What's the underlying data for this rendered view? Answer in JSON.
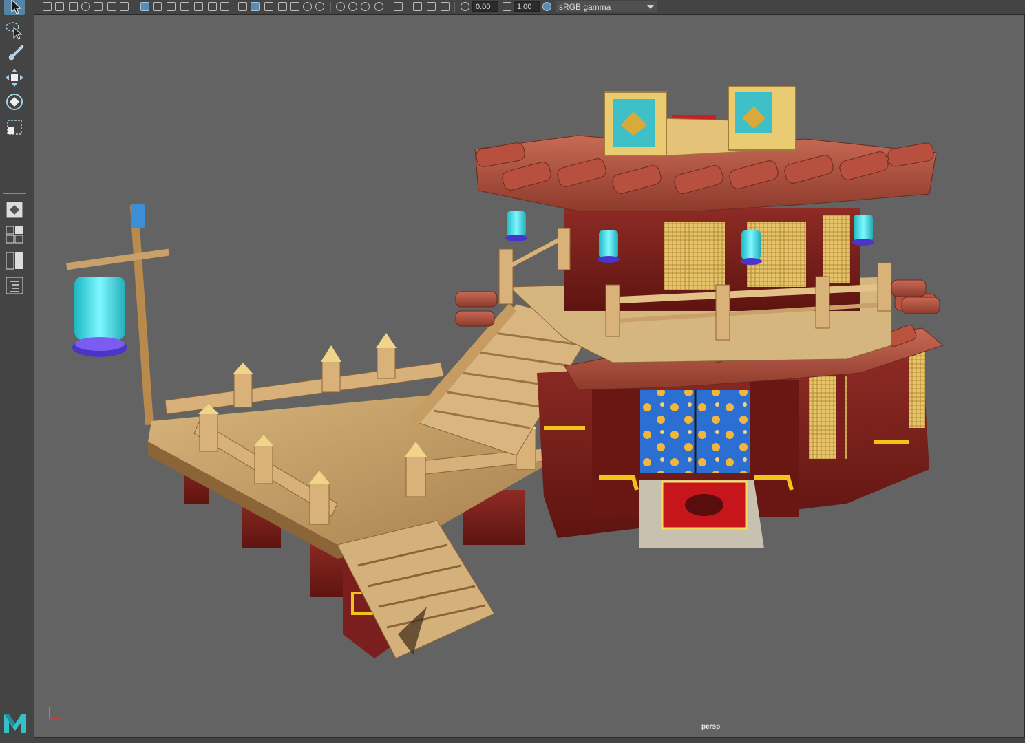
{
  "toolbar": {
    "exposure_value": "0.00",
    "gamma_value": "1.00",
    "color_space": {
      "selected": "sRGB gamma"
    }
  },
  "toolbox": {
    "tools": [
      {
        "name": "select-tool",
        "icon": "arrow-pointer-icon",
        "active": true
      },
      {
        "name": "lasso-tool",
        "icon": "lasso-icon"
      },
      {
        "name": "paint-select-tool",
        "icon": "paint-brush-icon"
      },
      {
        "name": "move-tool",
        "icon": "move-arrows-icon"
      },
      {
        "name": "rotate-tool",
        "icon": "rotate-icon"
      },
      {
        "name": "scale-tool",
        "icon": "scale-box-icon"
      }
    ],
    "layouts": [
      {
        "name": "single-perspective-layout",
        "icon": "single-pane-icon"
      },
      {
        "name": "four-view-layout",
        "icon": "four-pane-icon"
      },
      {
        "name": "side-by-side-layout",
        "icon": "two-pane-icon"
      },
      {
        "name": "outliner-layout",
        "icon": "outliner-icon"
      }
    ]
  },
  "viewport": {
    "camera_label": "persp",
    "background": "#636363"
  },
  "colors": {
    "accent": "#5285a6",
    "ui_bg": "#444444",
    "roof_tile": "#b7503f",
    "wood": "#c9a36b",
    "lacquer_red": "#7a1e1e",
    "lantern": "#3fe3e9",
    "gold_trim": "#f0c419"
  }
}
